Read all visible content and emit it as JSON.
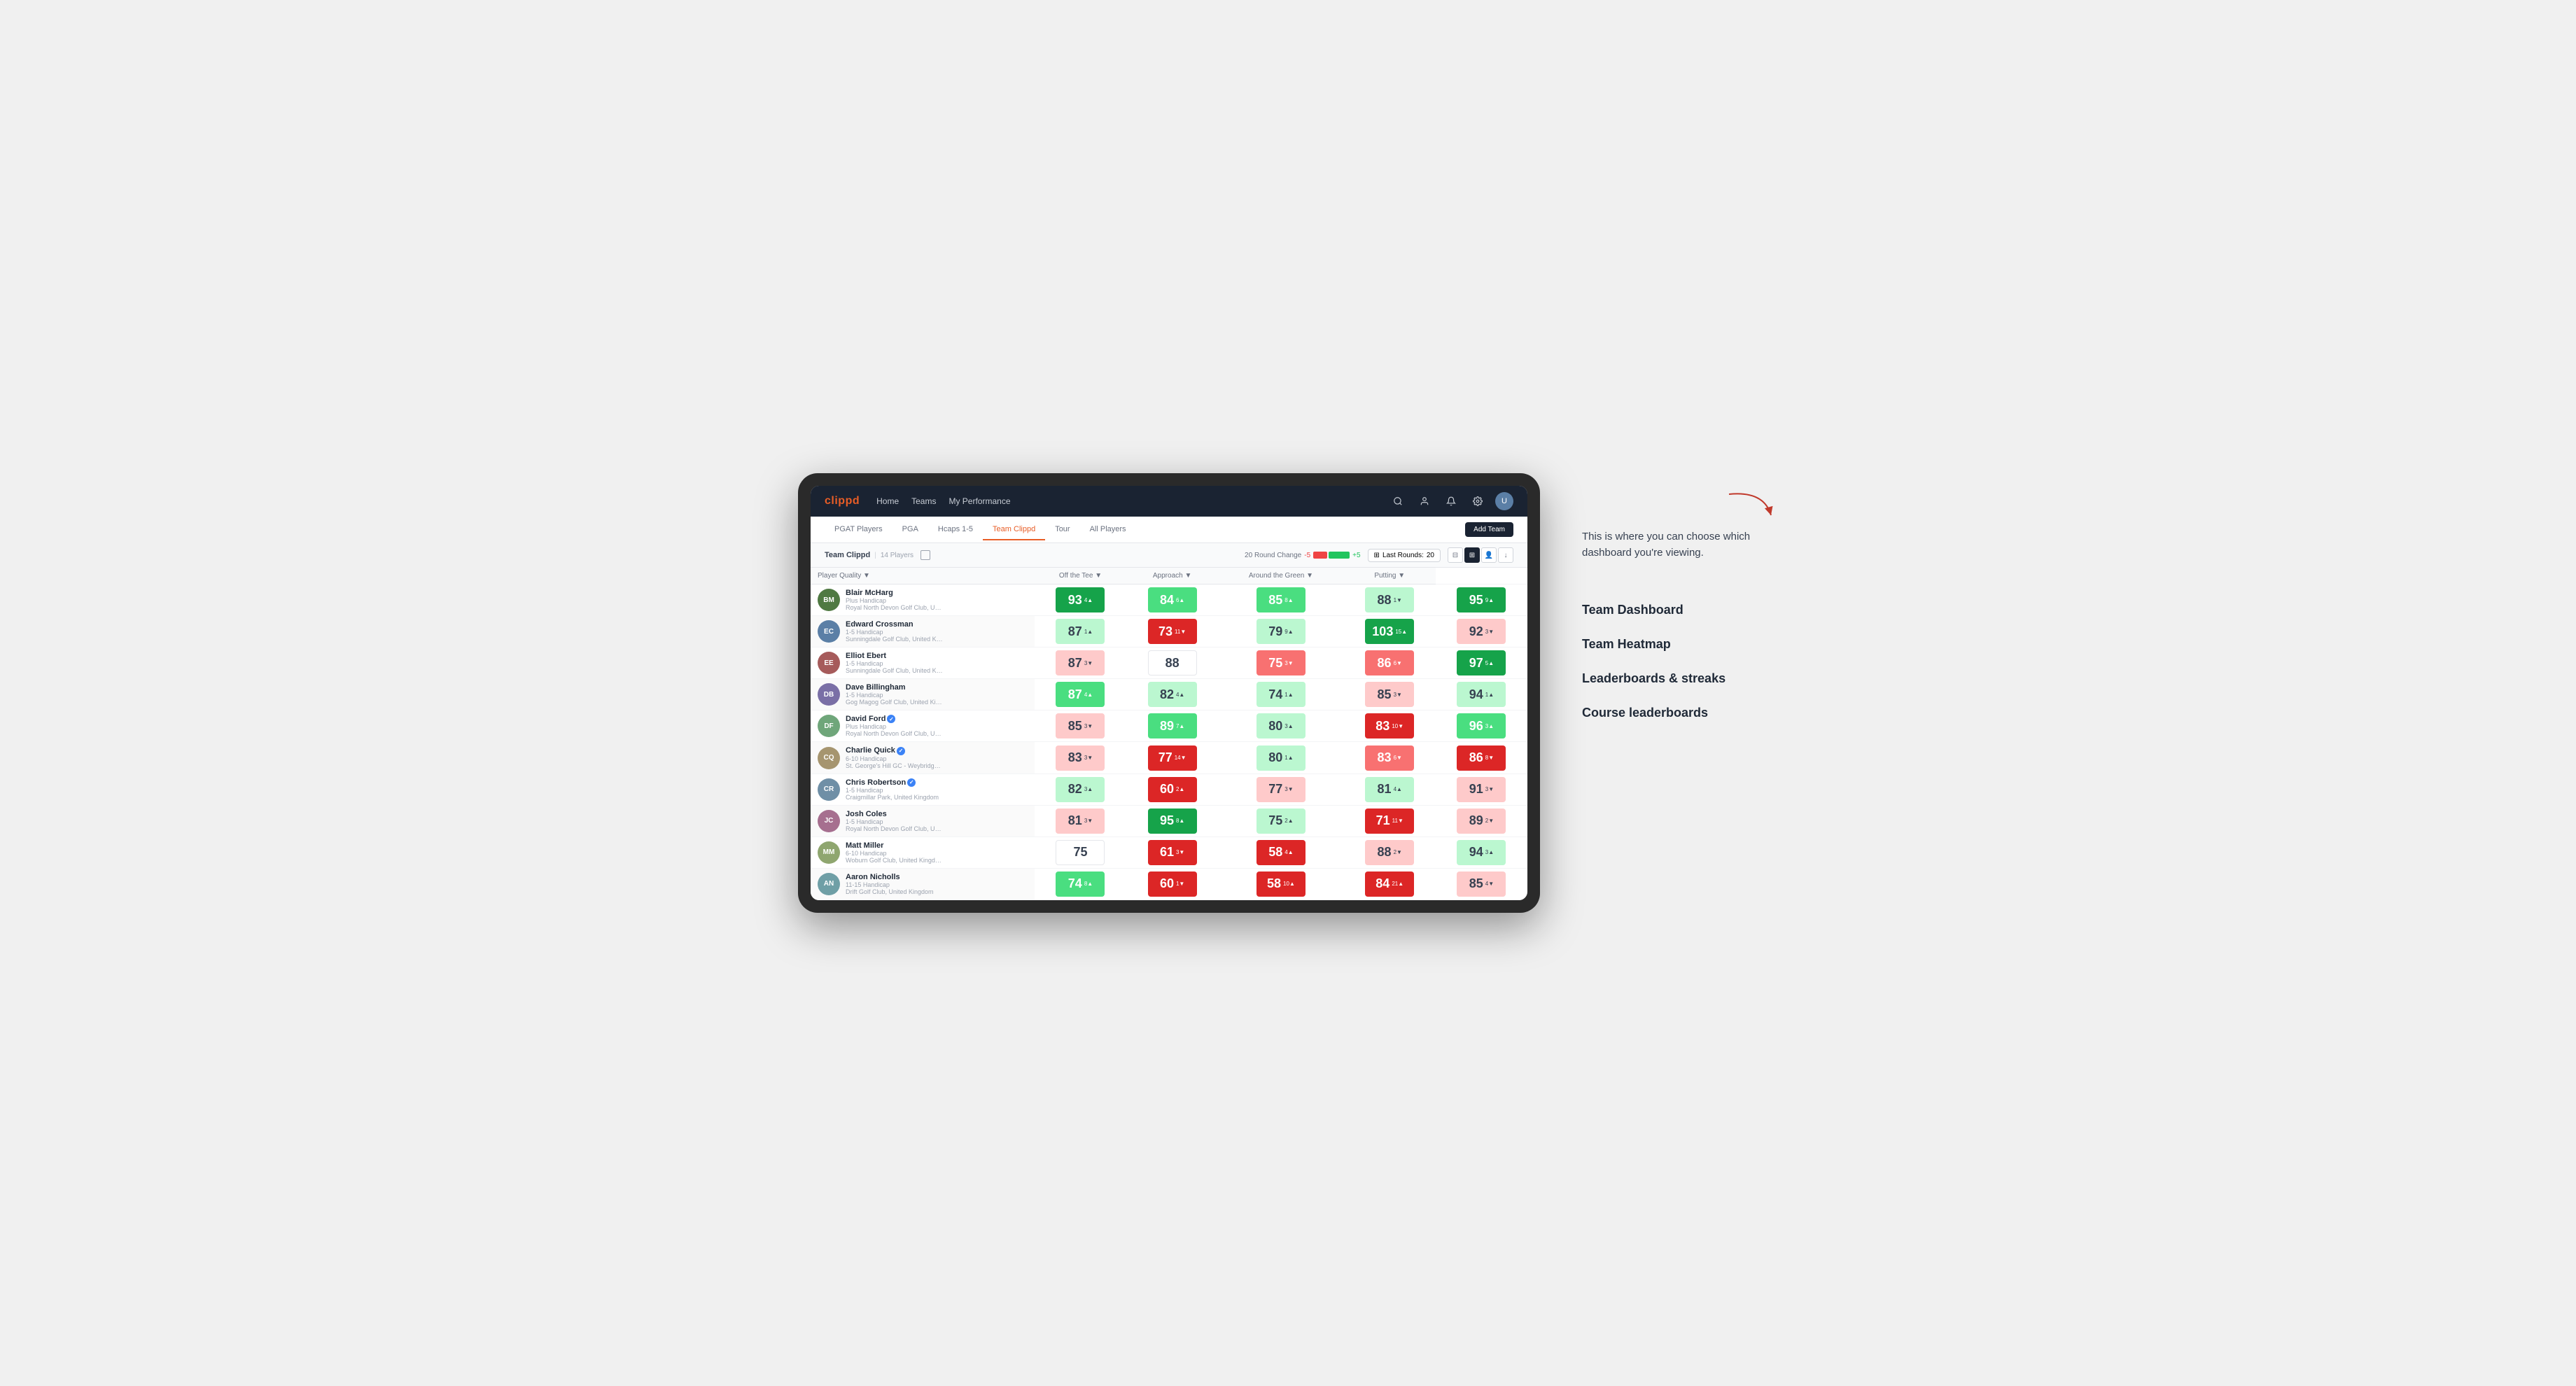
{
  "annotation": {
    "intro_text": "This is where you can choose which dashboard you're viewing.",
    "dashboard_options": [
      "Team Dashboard",
      "Team Heatmap",
      "Leaderboards & streaks",
      "Course leaderboards"
    ]
  },
  "navbar": {
    "logo": "clippd",
    "links": [
      "Home",
      "Teams",
      "My Performance"
    ],
    "icons": [
      "search",
      "person",
      "bell",
      "settings",
      "avatar"
    ]
  },
  "subnav": {
    "tabs": [
      "PGAT Players",
      "PGA",
      "Hcaps 1-5",
      "Team Clippd",
      "Tour",
      "All Players"
    ],
    "active_tab": "Team Clippd",
    "add_team_label": "Add Team"
  },
  "team_bar": {
    "team_name": "Team Clippd",
    "separator": "|",
    "player_count": "14 Players",
    "round_change_label": "20 Round Change",
    "change_neg": "-5",
    "change_pos": "+5",
    "last_rounds_label": "Last Rounds:",
    "last_rounds_value": "20"
  },
  "table": {
    "columns": [
      {
        "label": "Player Quality ▼",
        "key": "player_quality"
      },
      {
        "label": "Off the Tee ▼",
        "key": "off_tee"
      },
      {
        "label": "Approach ▼",
        "key": "approach"
      },
      {
        "label": "Around the Green ▼",
        "key": "around_green"
      },
      {
        "label": "Putting ▼",
        "key": "putting"
      }
    ],
    "players": [
      {
        "name": "Blair McHarg",
        "handicap": "Plus Handicap",
        "club": "Royal North Devon Golf Club, United Kingdom",
        "player_quality": {
          "val": "93",
          "change": "4▲",
          "bg": "green-dark"
        },
        "off_tee": {
          "val": "84",
          "change": "6▲",
          "bg": "green-mid"
        },
        "approach": {
          "val": "85",
          "change": "8▲",
          "bg": "green-mid"
        },
        "around_green": {
          "val": "88",
          "change": "1▼",
          "bg": "green-light"
        },
        "putting": {
          "val": "95",
          "change": "9▲",
          "bg": "green-dark"
        }
      },
      {
        "name": "Edward Crossman",
        "handicap": "1-5 Handicap",
        "club": "Sunningdale Golf Club, United Kingdom",
        "player_quality": {
          "val": "87",
          "change": "1▲",
          "bg": "green-light"
        },
        "off_tee": {
          "val": "73",
          "change": "11▼",
          "bg": "red-dark"
        },
        "approach": {
          "val": "79",
          "change": "9▲",
          "bg": "green-light"
        },
        "around_green": {
          "val": "103",
          "change": "15▲",
          "bg": "green-dark"
        },
        "putting": {
          "val": "92",
          "change": "3▼",
          "bg": "red-light"
        }
      },
      {
        "name": "Elliot Ebert",
        "handicap": "1-5 Handicap",
        "club": "Sunningdale Golf Club, United Kingdom",
        "player_quality": {
          "val": "87",
          "change": "3▼",
          "bg": "red-light"
        },
        "off_tee": {
          "val": "88",
          "change": "",
          "bg": "white"
        },
        "approach": {
          "val": "75",
          "change": "3▼",
          "bg": "red-mid"
        },
        "around_green": {
          "val": "86",
          "change": "6▼",
          "bg": "red-mid"
        },
        "putting": {
          "val": "97",
          "change": "5▲",
          "bg": "green-dark"
        }
      },
      {
        "name": "Dave Billingham",
        "handicap": "1-5 Handicap",
        "club": "Gog Magog Golf Club, United Kingdom",
        "player_quality": {
          "val": "87",
          "change": "4▲",
          "bg": "green-mid"
        },
        "off_tee": {
          "val": "82",
          "change": "4▲",
          "bg": "green-light"
        },
        "approach": {
          "val": "74",
          "change": "1▲",
          "bg": "green-light"
        },
        "around_green": {
          "val": "85",
          "change": "3▼",
          "bg": "red-light"
        },
        "putting": {
          "val": "94",
          "change": "1▲",
          "bg": "green-light"
        }
      },
      {
        "name": "David Ford",
        "handicap": "Plus Handicap",
        "club": "Royal North Devon Golf Club, United Kingdom",
        "verified": true,
        "player_quality": {
          "val": "85",
          "change": "3▼",
          "bg": "red-light"
        },
        "off_tee": {
          "val": "89",
          "change": "7▲",
          "bg": "green-mid"
        },
        "approach": {
          "val": "80",
          "change": "3▲",
          "bg": "green-light"
        },
        "around_green": {
          "val": "83",
          "change": "10▼",
          "bg": "red-dark"
        },
        "putting": {
          "val": "96",
          "change": "3▲",
          "bg": "green-mid"
        }
      },
      {
        "name": "Charlie Quick",
        "handicap": "6-10 Handicap",
        "club": "St. George's Hill GC - Weybridge - Surrey, Uni...",
        "verified": true,
        "player_quality": {
          "val": "83",
          "change": "3▼",
          "bg": "red-light"
        },
        "off_tee": {
          "val": "77",
          "change": "14▼",
          "bg": "red-dark"
        },
        "approach": {
          "val": "80",
          "change": "1▲",
          "bg": "green-light"
        },
        "around_green": {
          "val": "83",
          "change": "6▼",
          "bg": "red-mid"
        },
        "putting": {
          "val": "86",
          "change": "8▼",
          "bg": "red-dark"
        }
      },
      {
        "name": "Chris Robertson",
        "handicap": "1-5 Handicap",
        "club": "Craigmillar Park, United Kingdom",
        "verified": true,
        "player_quality": {
          "val": "82",
          "change": "3▲",
          "bg": "green-light"
        },
        "off_tee": {
          "val": "60",
          "change": "2▲",
          "bg": "red-dark"
        },
        "approach": {
          "val": "77",
          "change": "3▼",
          "bg": "red-light"
        },
        "around_green": {
          "val": "81",
          "change": "4▲",
          "bg": "green-light"
        },
        "putting": {
          "val": "91",
          "change": "3▼",
          "bg": "red-light"
        }
      },
      {
        "name": "Josh Coles",
        "handicap": "1-5 Handicap",
        "club": "Royal North Devon Golf Club, United Kingdom",
        "player_quality": {
          "val": "81",
          "change": "3▼",
          "bg": "red-light"
        },
        "off_tee": {
          "val": "95",
          "change": "8▲",
          "bg": "green-dark"
        },
        "approach": {
          "val": "75",
          "change": "2▲",
          "bg": "green-light"
        },
        "around_green": {
          "val": "71",
          "change": "11▼",
          "bg": "red-dark"
        },
        "putting": {
          "val": "89",
          "change": "2▼",
          "bg": "red-light"
        }
      },
      {
        "name": "Matt Miller",
        "handicap": "6-10 Handicap",
        "club": "Woburn Golf Club, United Kingdom",
        "player_quality": {
          "val": "75",
          "change": "",
          "bg": "white"
        },
        "off_tee": {
          "val": "61",
          "change": "3▼",
          "bg": "red-dark"
        },
        "approach": {
          "val": "58",
          "change": "4▲",
          "bg": "red-dark"
        },
        "around_green": {
          "val": "88",
          "change": "2▼",
          "bg": "red-light"
        },
        "putting": {
          "val": "94",
          "change": "3▲",
          "bg": "green-light"
        }
      },
      {
        "name": "Aaron Nicholls",
        "handicap": "11-15 Handicap",
        "club": "Drift Golf Club, United Kingdom",
        "player_quality": {
          "val": "74",
          "change": "8▲",
          "bg": "green-mid"
        },
        "off_tee": {
          "val": "60",
          "change": "1▼",
          "bg": "red-dark"
        },
        "approach": {
          "val": "58",
          "change": "10▲",
          "bg": "red-dark"
        },
        "around_green": {
          "val": "84",
          "change": "21▲",
          "bg": "red-dark"
        },
        "putting": {
          "val": "85",
          "change": "4▼",
          "bg": "red-light"
        }
      }
    ]
  }
}
